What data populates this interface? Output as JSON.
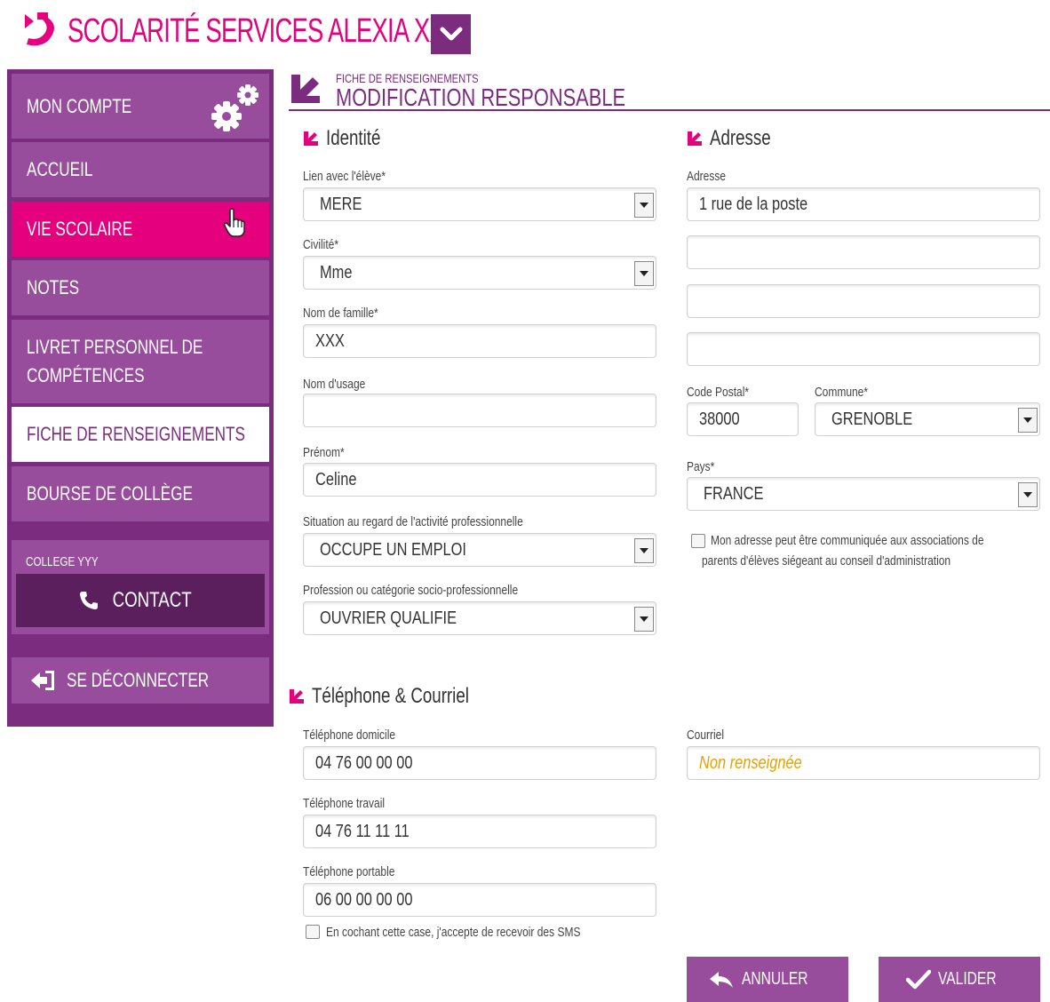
{
  "header": {
    "app_title": "SCOLARITÉ SERVICES ALEXIA XXX"
  },
  "sidebar": {
    "items": [
      {
        "label": "MON COMPTE"
      },
      {
        "label": "ACCUEIL"
      },
      {
        "label": "VIE SCOLAIRE"
      },
      {
        "label": "NOTES"
      },
      {
        "label_line1": "LIVRET PERSONNEL DE",
        "label_line2": "COMPÉTENCES"
      },
      {
        "label": "FICHE DE RENSEIGNEMENTS"
      },
      {
        "label": "BOURSE DE COLLÈGE"
      }
    ],
    "college_name": "COLLEGE YYY",
    "contact_label": "CONTACT",
    "logout_label": "SE DÉCONNECTER"
  },
  "page": {
    "breadcrumb": "FICHE DE RENSEIGNEMENTS",
    "title": "MODIFICATION RESPONSABLE"
  },
  "identity": {
    "heading": "Identité",
    "lien_label": "Lien avec l'élève*",
    "lien_value": "MERE",
    "civilite_label": "Civilité*",
    "civilite_value": "Mme",
    "nom_famille_label": "Nom de famille*",
    "nom_famille_value": "XXX",
    "nom_usage_label": "Nom d'usage",
    "nom_usage_value": "",
    "prenom_label": "Prénom*",
    "prenom_value": "Celine",
    "situation_label": "Situation au regard de l'activité professionnelle",
    "situation_value": "OCCUPE UN EMPLOI",
    "profession_label": "Profession ou catégorie socio-professionnelle",
    "profession_value": "OUVRIER QUALIFIE"
  },
  "address": {
    "heading": "Adresse",
    "adresse_label": "Adresse",
    "line1": "1 rue de la poste",
    "line2": "",
    "line3": "",
    "line4": "",
    "cp_label": "Code Postal*",
    "cp_value": "38000",
    "commune_label": "Commune*",
    "commune_value": "GRENOBLE",
    "pays_label": "Pays*",
    "pays_value": "FRANCE",
    "consent_line1": "Mon adresse peut être communiquée aux associations de",
    "consent_line2": "parents d'élèves siégeant au conseil d'administration"
  },
  "contact": {
    "heading": "Téléphone & Courriel",
    "tel_dom_label": "Téléphone domicile",
    "tel_dom_value": "04 76 00 00 00",
    "tel_travail_label": "Téléphone travail",
    "tel_travail_value": "04 76 11 11 11",
    "tel_portable_label": "Téléphone portable",
    "tel_portable_value": "06 00 00 00 00",
    "sms_label": "En cochant cette case, j'accepte de recevoir des SMS",
    "courriel_label": "Courriel",
    "courriel_placeholder": "Non renseignée"
  },
  "actions": {
    "cancel": "ANNULER",
    "submit": "VALIDER"
  },
  "colors": {
    "brand_magenta": "#e5007e",
    "brand_purple": "#7b2c7f",
    "menu_purple": "#984c9c",
    "dark_purple": "#5b1f5e",
    "placeholder_orange": "#e8a000"
  }
}
